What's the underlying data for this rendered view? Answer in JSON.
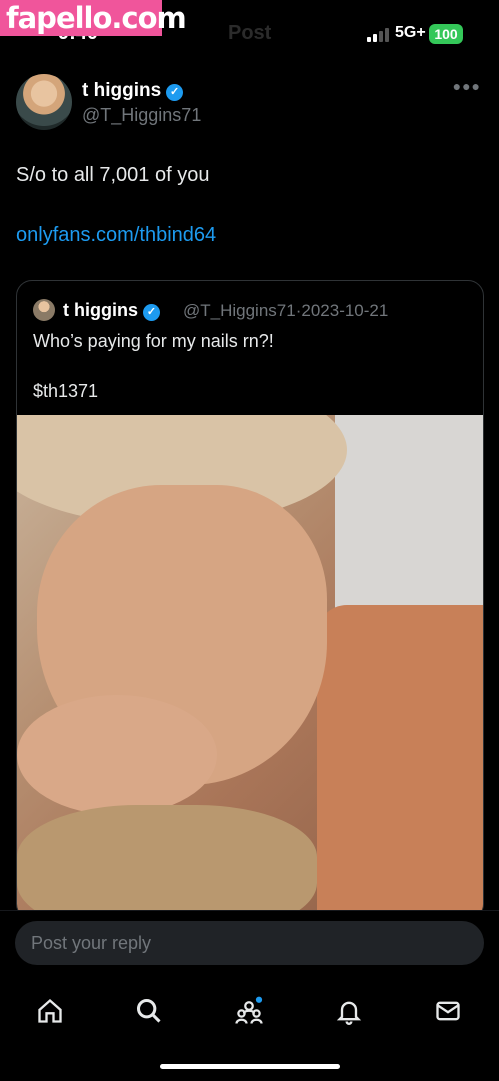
{
  "watermark": "fapello.com",
  "status": {
    "time": "9:40",
    "title": "Post",
    "network": "5G+",
    "battery": "100"
  },
  "tweet": {
    "display_name": "t higgins",
    "handle": "@T_Higgins71",
    "text": "S/o to all 7,001 of you",
    "link": "onlyfans.com/thbind64"
  },
  "quote": {
    "display_name": "t higgins",
    "handle": "@T_Higgins71",
    "separator": "·",
    "date": "2023-10-21",
    "text": "Who’s paying for my nails rn?!",
    "cashtag": "$th1371"
  },
  "reply": {
    "placeholder": "Post your reply"
  },
  "nav": {
    "items": [
      "home-icon",
      "search-icon",
      "communities-icon",
      "notifications-icon",
      "messages-icon"
    ]
  },
  "colors": {
    "accent": "#1d9bf0",
    "background": "#000000",
    "battery": "#34c759",
    "watermark": "#f0559b"
  }
}
